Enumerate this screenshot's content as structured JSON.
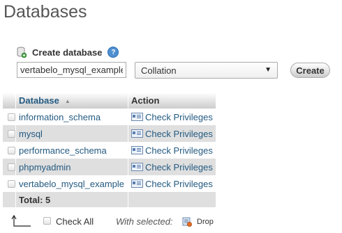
{
  "page": {
    "title": "Databases"
  },
  "create": {
    "label": "Create database",
    "input_value": "vertabelo_mysql_example",
    "collation_value": "Collation",
    "button_label": "Create"
  },
  "table": {
    "headers": {
      "database": "Database",
      "action": "Action"
    },
    "rows": [
      {
        "name": "information_schema",
        "action": "Check Privileges"
      },
      {
        "name": "mysql",
        "action": "Check Privileges"
      },
      {
        "name": "performance_schema",
        "action": "Check Privileges"
      },
      {
        "name": "phpmyadmin",
        "action": "Check Privileges"
      },
      {
        "name": "vertabelo_mysql_example",
        "action": "Check Privileges"
      }
    ],
    "total_label": "Total: 5"
  },
  "footer": {
    "check_all": "Check All",
    "with_selected": "With selected:",
    "drop": "Drop"
  },
  "icons": {
    "create": "database-add-icon",
    "help": "help-icon",
    "priv": "check-privileges-icon",
    "drop": "drop-icon",
    "arrow": "arrow-up-icon"
  }
}
